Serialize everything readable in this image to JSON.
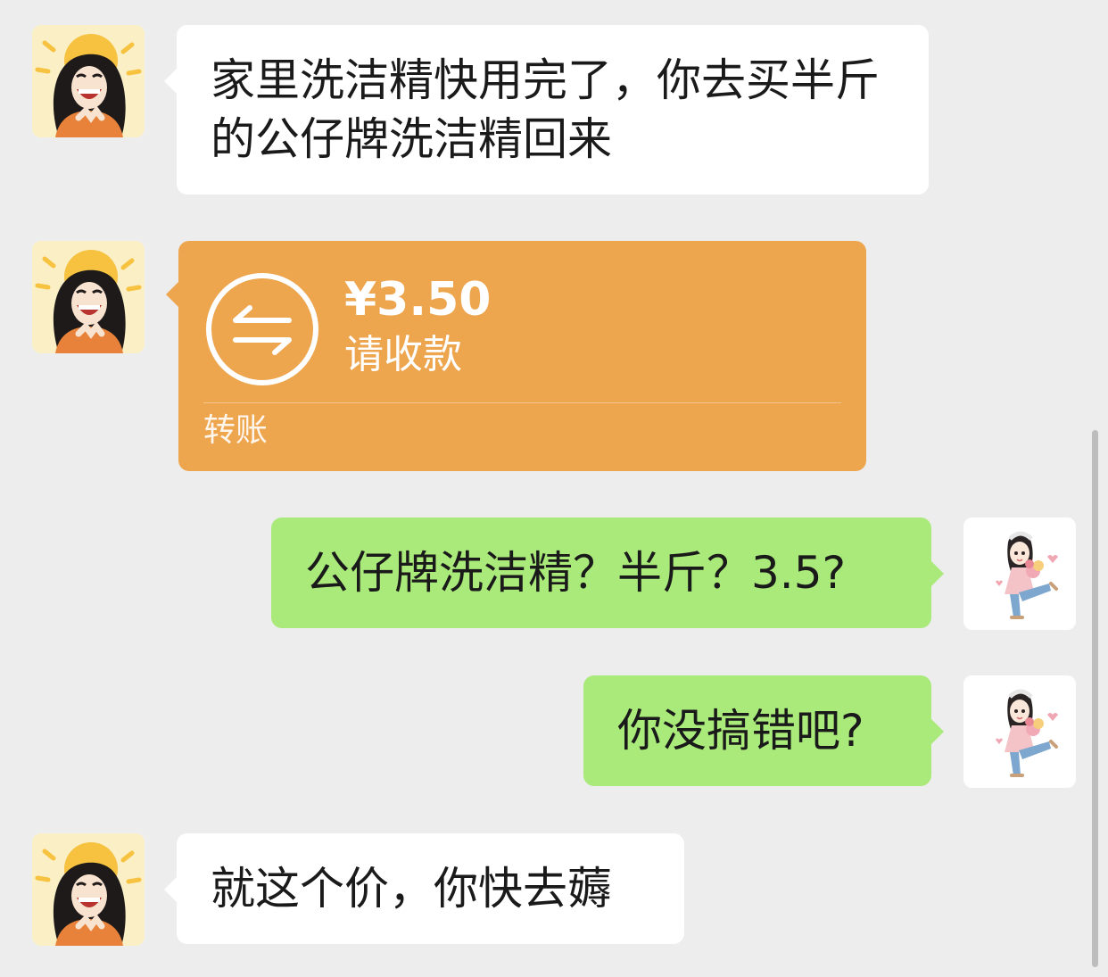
{
  "messages": {
    "m1": {
      "text": "家里洗洁精快用完了，你去买半斤的公仔牌洗洁精回来"
    },
    "m2": {
      "amount": "¥3.50",
      "status": "请收款",
      "label": "转账"
    },
    "m3": {
      "text": "公仔牌洗洁精？半斤？3.5?"
    },
    "m4": {
      "text": "你没搞错吧?"
    },
    "m5": {
      "text": "就这个价，你快去薅"
    }
  },
  "colors": {
    "background": "#ededed",
    "incoming_bubble": "#ffffff",
    "outgoing_bubble": "#a9ea7a",
    "transfer_card": "#eda54e"
  },
  "icons": {
    "contact_avatar": "cartoon-girl-laughing-avatar",
    "self_avatar": "cartoon-girl-with-flowers-avatar",
    "transfer": "transfer-arrows-icon"
  }
}
